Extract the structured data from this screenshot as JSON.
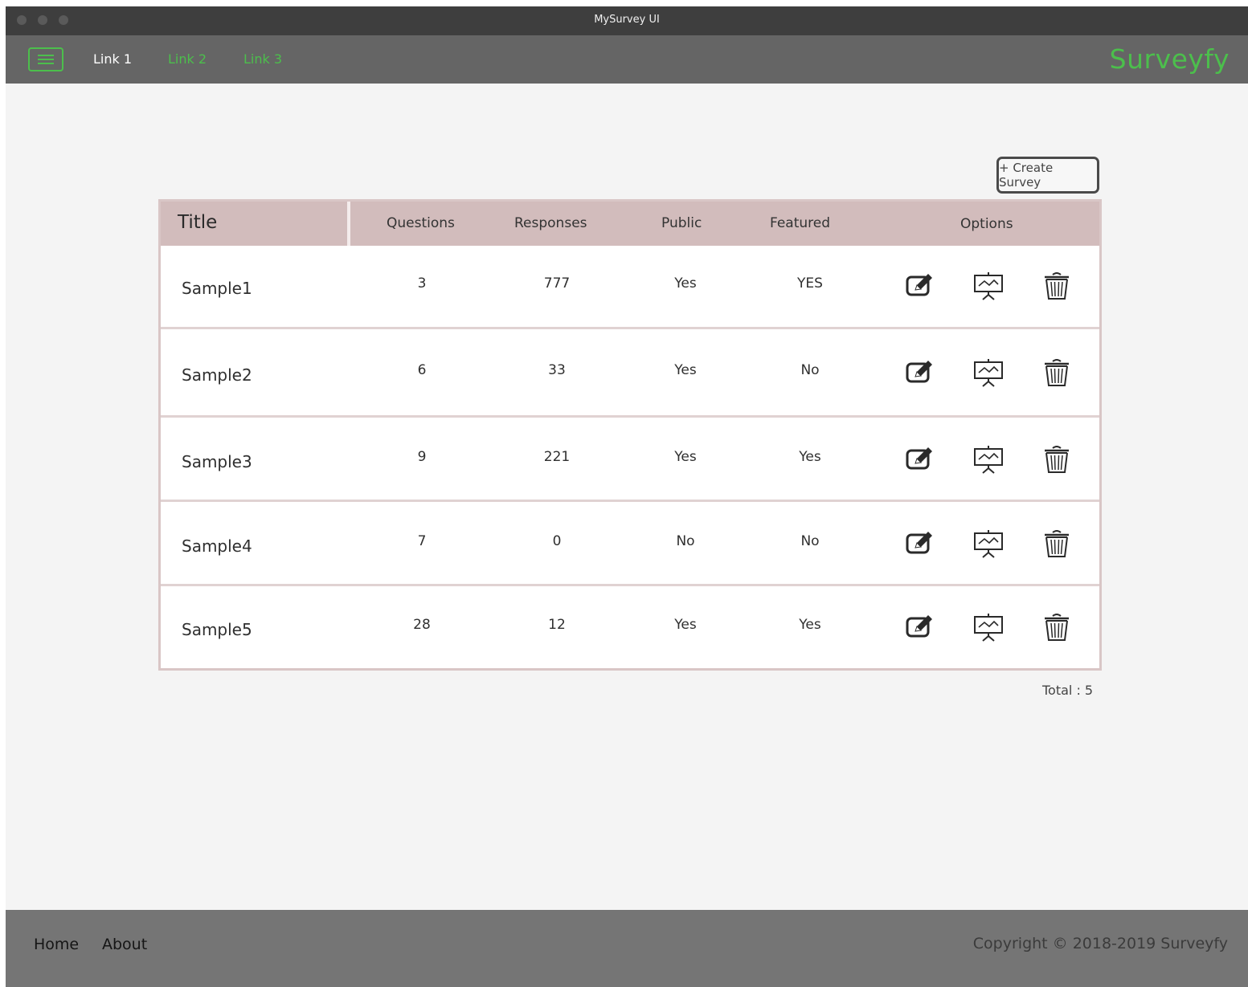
{
  "window": {
    "title": "MySurvey UI"
  },
  "navbar": {
    "links": [
      {
        "label": "Link 1",
        "color": "#ffffff"
      },
      {
        "label": "Link 2",
        "color": "#4cbf4c"
      },
      {
        "label": "Link 3",
        "color": "#4cbf4c"
      }
    ],
    "brand": "Surveyfy",
    "menu_icon": "hamburger-icon"
  },
  "main": {
    "create_button": "+ Create Survey",
    "table": {
      "headers": {
        "title": "Title",
        "questions": "Questions",
        "responses": "Responses",
        "public": "Public",
        "featured": "Featured",
        "options": "Options"
      },
      "rows": [
        {
          "title": "Sample1",
          "questions": "3",
          "responses": "777",
          "public": "Yes",
          "featured": "YES"
        },
        {
          "title": "Sample2",
          "questions": "6",
          "responses": "33",
          "public": "Yes",
          "featured": "No"
        },
        {
          "title": "Sample3",
          "questions": "9",
          "responses": "221",
          "public": "Yes",
          "featured": "Yes"
        },
        {
          "title": "Sample4",
          "questions": "7",
          "responses": "0",
          "public": "No",
          "featured": "No"
        },
        {
          "title": "Sample5",
          "questions": "28",
          "responses": "12",
          "public": "Yes",
          "featured": "Yes"
        }
      ],
      "option_icons": [
        "edit-icon",
        "presentation-chart-icon",
        "trash-icon"
      ]
    },
    "total": "Total : 5"
  },
  "footer": {
    "links": [
      "Home",
      "About"
    ],
    "copyright": "Copyright © 2018-2019 Surveyfy"
  },
  "colors": {
    "accent": "#4cbf4c",
    "titlebar": "#3e3e3e",
    "navbar": "#656565",
    "footer": "#757575",
    "table_header": "#d2bcbc",
    "table_border": "#d9c6c6"
  }
}
